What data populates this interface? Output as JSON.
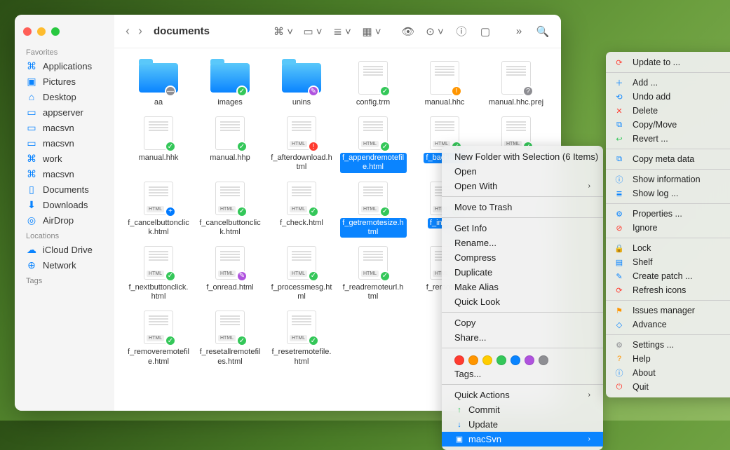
{
  "window": {
    "title": "documents"
  },
  "sidebar": {
    "sections": [
      {
        "heading": "Favorites",
        "items": [
          {
            "icon": "⌘",
            "label": "Applications"
          },
          {
            "icon": "▣",
            "label": "Pictures"
          },
          {
            "icon": "⌂",
            "label": "Desktop"
          },
          {
            "icon": "▭",
            "label": "appserver"
          },
          {
            "icon": "▭",
            "label": "macsvn"
          },
          {
            "icon": "▭",
            "label": "macsvn"
          },
          {
            "icon": "⌘",
            "label": "work"
          },
          {
            "icon": "⌘",
            "label": "macsvn"
          },
          {
            "icon": "▯",
            "label": "Documents"
          },
          {
            "icon": "⬇",
            "label": "Downloads"
          },
          {
            "icon": "◎",
            "label": "AirDrop"
          }
        ]
      },
      {
        "heading": "Locations",
        "items": [
          {
            "icon": "☁",
            "label": "iCloud Drive"
          },
          {
            "icon": "⊕",
            "label": "Network"
          }
        ]
      },
      {
        "heading": "Tags",
        "items": []
      }
    ]
  },
  "files": [
    [
      {
        "name": "aa",
        "type": "folder",
        "badge": "no"
      },
      {
        "name": "images",
        "type": "folder",
        "badge": "ok"
      },
      {
        "name": "unins",
        "type": "folder",
        "badge": "purple"
      },
      {
        "name": "config.trm",
        "type": "file",
        "badge": "ok"
      },
      {
        "name": "manual.hhc",
        "type": "file",
        "badge": "warn"
      },
      {
        "name": "manual.hhc.prej",
        "type": "file",
        "badge": "q"
      }
    ],
    [
      {
        "name": "manual.hhk",
        "type": "file",
        "badge": "ok"
      },
      {
        "name": "manual.hhp",
        "type": "file",
        "badge": "ok"
      },
      {
        "name": "f_afterdownload.html",
        "type": "html",
        "badge": "red"
      },
      {
        "name": "f_appendremotefile.html",
        "type": "html",
        "badge": "ok",
        "sel": true
      },
      {
        "name": "f_backbc.h",
        "type": "html",
        "badge": "ok",
        "sel": true
      },
      {
        "name": "",
        "type": "html",
        "badge": "ok",
        "sel": true
      }
    ],
    [
      {
        "name": "f_cancelbuttonclick.html",
        "type": "html",
        "badge": "plus"
      },
      {
        "name": "f_cancelbuttonclick.html",
        "type": "html",
        "badge": "ok"
      },
      {
        "name": "f_check.html",
        "type": "html",
        "badge": "ok"
      },
      {
        "name": "f_getremotesize.html",
        "type": "html",
        "badge": "ok",
        "sel": true
      },
      {
        "name": "f_initializ",
        "type": "html",
        "badge": "ok",
        "sel": true
      },
      {
        "name": "",
        "type": "html",
        "badge": "ok",
        "sel": true
      }
    ],
    [
      {
        "name": "f_nextbuttonclick.html",
        "type": "html",
        "badge": "ok"
      },
      {
        "name": "f_onread.html",
        "type": "html",
        "badge": "purple"
      },
      {
        "name": "f_processmesg.html",
        "type": "html",
        "badge": "ok"
      },
      {
        "name": "f_readremoteurl.html",
        "type": "html",
        "badge": "ok"
      },
      {
        "name": "f_remote.h",
        "type": "html",
        "badge": "ok"
      },
      {
        "name": "",
        "type": "",
        "badge": ""
      }
    ],
    [
      {
        "name": "f_removeremotefile.html",
        "type": "html",
        "badge": "ok"
      },
      {
        "name": "f_resetallremotefiles.html",
        "type": "html",
        "badge": "ok"
      },
      {
        "name": "f_resetremotefile.html",
        "type": "html",
        "badge": "ok"
      }
    ]
  ],
  "context_menu": {
    "items": [
      {
        "label": "New Folder with Selection (6 Items)"
      },
      {
        "label": "Open"
      },
      {
        "label": "Open With",
        "submenu": true
      },
      {
        "sep": true
      },
      {
        "label": "Move to Trash"
      },
      {
        "sep": true
      },
      {
        "label": "Get Info"
      },
      {
        "label": "Rename..."
      },
      {
        "label": "Compress"
      },
      {
        "label": "Duplicate"
      },
      {
        "label": "Make Alias"
      },
      {
        "label": "Quick Look"
      },
      {
        "sep": true
      },
      {
        "label": "Copy"
      },
      {
        "label": "Share..."
      },
      {
        "sep": true
      },
      {
        "tags": true
      },
      {
        "label": "Tags..."
      },
      {
        "sep": true
      },
      {
        "label": "Quick Actions",
        "submenu": true
      },
      {
        "label": "Commit",
        "icon": "↑",
        "iconColor": "#34c759"
      },
      {
        "label": "Update",
        "icon": "↓",
        "iconColor": "#0a84ff"
      },
      {
        "label": "macSvn",
        "icon": "▣",
        "iconColor": "#fff",
        "highlight": true,
        "submenu": true
      }
    ],
    "tag_colors": [
      "#ff3b30",
      "#ff9500",
      "#ffcc00",
      "#34c759",
      "#0a84ff",
      "#af52de",
      "#8e8e93"
    ]
  },
  "submenu": {
    "items": [
      {
        "label": "Update to ...",
        "icon": "⟳",
        "color": "#ff3b30"
      },
      {
        "sep": true
      },
      {
        "label": "Add ...",
        "icon": "＋",
        "color": "#0a84ff"
      },
      {
        "label": "Undo add",
        "icon": "⟲",
        "color": "#0a84ff"
      },
      {
        "label": "Delete",
        "icon": "✕",
        "color": "#ff3b30",
        "submenu": true
      },
      {
        "label": "Copy/Move",
        "icon": "⧉",
        "color": "#0a84ff",
        "submenu": true
      },
      {
        "label": "Revert ...",
        "icon": "↩",
        "color": "#34c759"
      },
      {
        "sep": true
      },
      {
        "label": "Copy meta data",
        "icon": "⧉",
        "color": "#0a84ff",
        "submenu": true
      },
      {
        "sep": true
      },
      {
        "label": "Show information",
        "icon": "ⓘ",
        "color": "#0a84ff"
      },
      {
        "label": "Show log ...",
        "icon": "≣",
        "color": "#0a84ff"
      },
      {
        "sep": true
      },
      {
        "label": "Properties ...",
        "icon": "⚙",
        "color": "#0a84ff"
      },
      {
        "label": "Ignore",
        "icon": "⊘",
        "color": "#ff3b30",
        "submenu": true
      },
      {
        "sep": true
      },
      {
        "label": "Lock",
        "icon": "🔒",
        "color": "#0a84ff"
      },
      {
        "label": "Shelf",
        "icon": "▤",
        "color": "#0a84ff",
        "submenu": true
      },
      {
        "label": "Create patch ...",
        "icon": "✎",
        "color": "#0a84ff"
      },
      {
        "label": "Refresh icons",
        "icon": "⟳",
        "color": "#ff3b30"
      },
      {
        "sep": true
      },
      {
        "label": "Issues manager",
        "icon": "⚑",
        "color": "#ff9500"
      },
      {
        "label": "Advance",
        "icon": "◇",
        "color": "#0a84ff",
        "submenu": true
      },
      {
        "sep": true
      },
      {
        "label": "Settings ...",
        "icon": "⚙",
        "color": "#8e8e93"
      },
      {
        "label": "Help",
        "icon": "?",
        "color": "#ff9500"
      },
      {
        "label": "About",
        "icon": "ⓘ",
        "color": "#0a84ff"
      },
      {
        "label": "Quit",
        "icon": "⏻",
        "color": "#ff3b30"
      }
    ]
  }
}
